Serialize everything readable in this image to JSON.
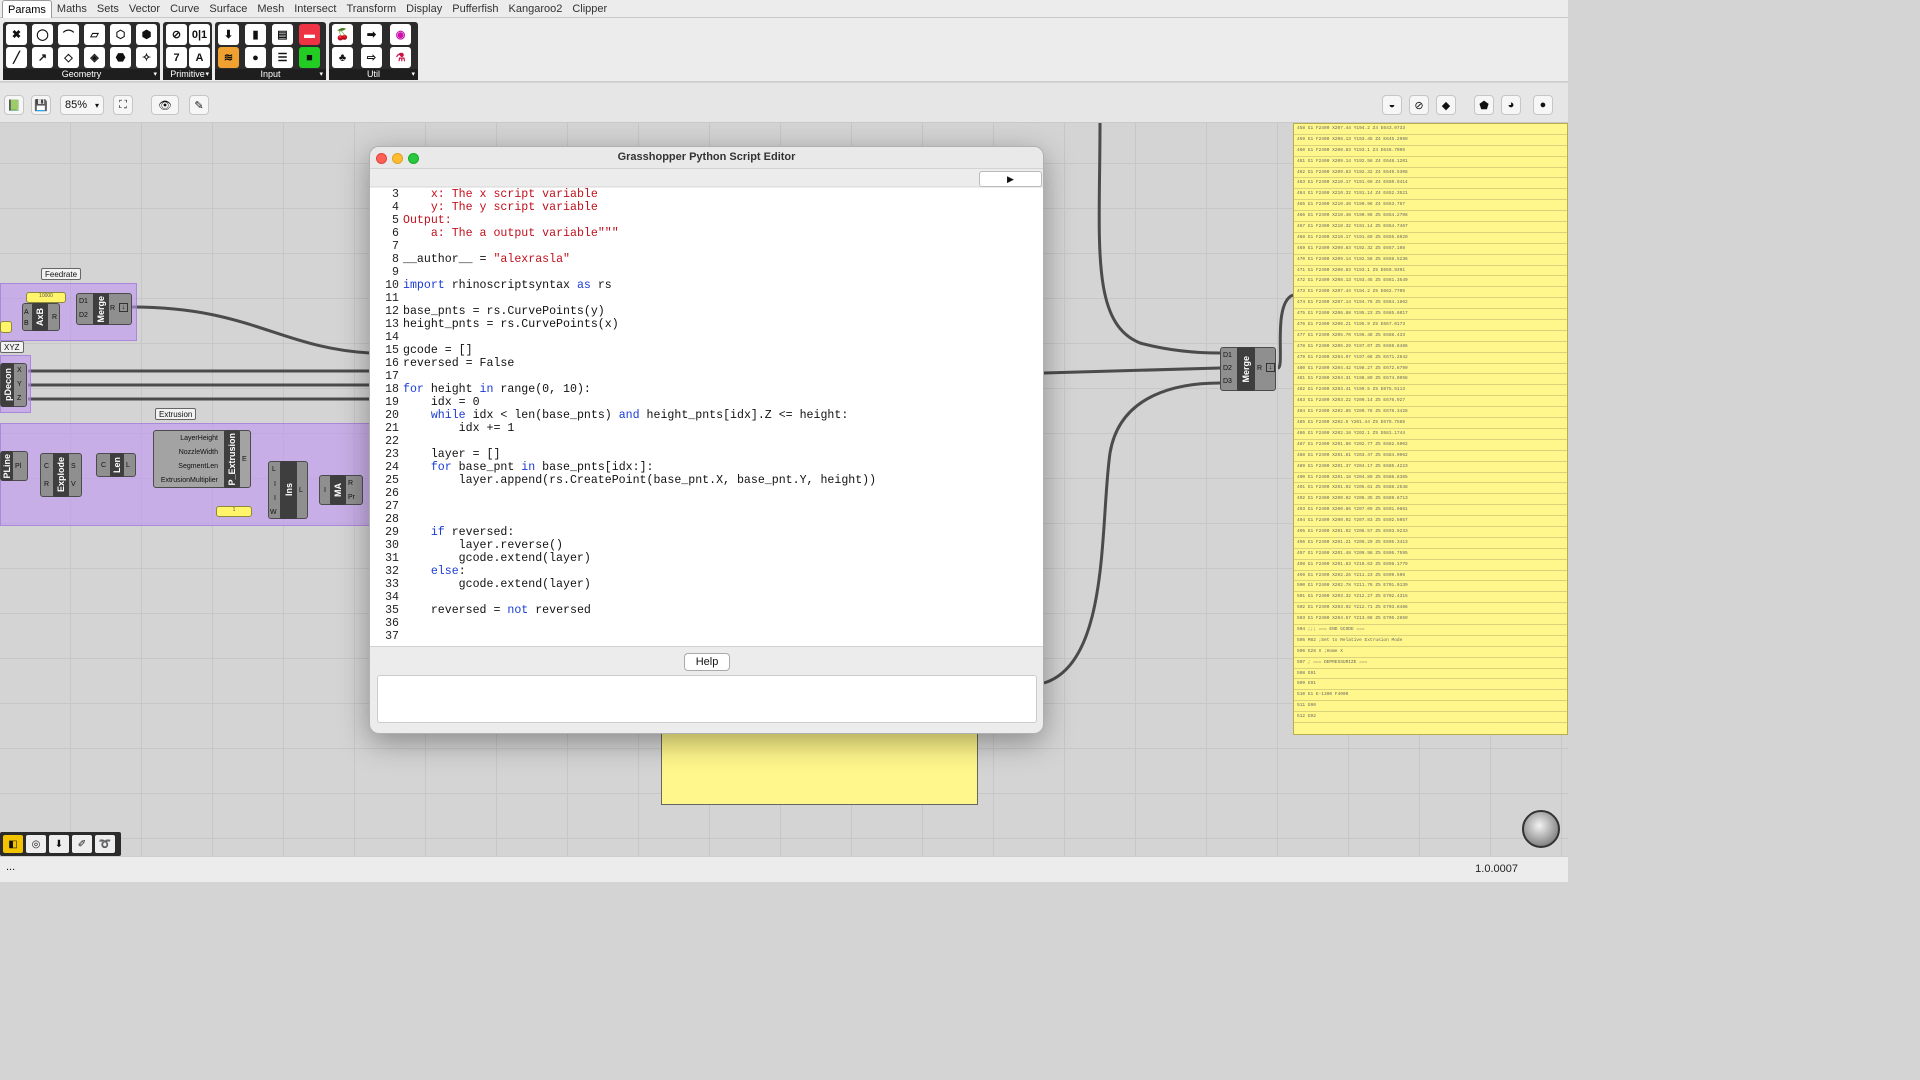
{
  "menu": {
    "tabs": [
      "Params",
      "Maths",
      "Sets",
      "Vector",
      "Curve",
      "Surface",
      "Mesh",
      "Intersect",
      "Transform",
      "Display",
      "Pufferfish",
      "Kangaroo2",
      "Clipper"
    ],
    "active": "Params"
  },
  "ribbon": {
    "geometry_label": "Geometry",
    "primitive_label": "Primitive",
    "input_label": "Input",
    "util_label": "Util",
    "prim_btn_01": "0|1",
    "prim_btn_7": "7",
    "prim_btn_A": "A"
  },
  "toolbar": {
    "zoom_value": "85%"
  },
  "canvas": {
    "group_labels": {
      "feedrate": "Feedrate",
      "xyz": "XYZ",
      "extrusion": "Extrusion"
    },
    "components": {
      "axb": {
        "name": "AxB",
        "inputs": [
          "A",
          "B"
        ],
        "outputs": [
          "R"
        ]
      },
      "merge_left": {
        "name": "Merge",
        "inputs": [
          "D1",
          "D2"
        ],
        "outputs": [
          "R"
        ]
      },
      "pdecon": {
        "name": "pDecon",
        "outputs": [
          "X",
          "Y",
          "Z"
        ]
      },
      "pline": {
        "name": "PLine",
        "outputs": [
          "Pl"
        ]
      },
      "explode": {
        "name": "Explode",
        "inputs": [
          "C"
        ],
        "outputs": [
          "S",
          "V"
        ],
        "right_inputs": [
          "R"
        ]
      },
      "len": {
        "name": "Len",
        "inputs": [
          "C"
        ],
        "outputs": [
          "L"
        ]
      },
      "pextrusion": {
        "name": "P_Extrusion",
        "inputs": [
          "LayerHeight",
          "NozzleWidth",
          "SegmentLen",
          "ExtrusionMultiplier"
        ],
        "outputs": [
          "E"
        ]
      },
      "ins": {
        "name": "Ins",
        "inputs": [
          "L",
          "I",
          "I",
          "W"
        ],
        "outputs": [
          "L"
        ]
      },
      "ma": {
        "name": "MA",
        "inputs": [
          "I"
        ],
        "outputs": [
          "R",
          "Pr"
        ]
      },
      "merge_right": {
        "name": "Merge",
        "inputs": [
          "D1",
          "D2",
          "D3"
        ],
        "outputs": [
          "R"
        ]
      }
    },
    "feedrate_value": "10000",
    "slider_value": "1"
  },
  "gcode_lines": [
    "458 G1  F2400 X207.44 Y194.2 Z4 E643.0733",
    "459 G1  F2400 X208.13 Y193.45 Z4 E645.2989",
    "460 G1  F2400 X208.83 Y193.1 Z4 E646.7095",
    "461 G1  F2400 X209.14 Y192.58 Z4 E648.1201",
    "462 G1  F2400 X209.83 Y192.32 Z4 E649.5308",
    "463 G1  F2400 X210.17 Y191.69 Z4 E650.9414",
    "464 G1  F2400 X210.32 Y191.14 Z4 E652.3521",
    "465 G1  F2400 X210.48 Y190.96 Z4 E653.767",
    "466 G1  F2400 X210.48 Y190.96 Z5 E654.2708",
    "467 G1  F2400 X210.32 Y191.14 Z5 E654.7467",
    "468 G1  F2400 X210.17 Y191.69 Z5 E655.6920",
    "469 G1  F2400 X209.83 Y192.32 Z5 E657.108",
    "470 G1  F2400 X209.14 Y192.58 Z5 E658.5236",
    "471 G1  F2400 X208.83 Y193.1 Z5 E659.9391",
    "472 G1  F2400 X208.13 Y193.45 Z5 E661.3549",
    "473 G1  F2400 X207.44 Y194.2 Z5 E662.7705",
    "474 G1  F2400 X207.14 Y194.76 Z5 E664.1862",
    "475 G1  F2400 X206.88 Y195.23 Z5 E665.6017",
    "476 G1  F2400 X206.21 Y195.9 Z5 E667.0173",
    "477 G1  F2400 X205.70 Y196.48 Z5 E668.433",
    "478 G1  F2400 X205.29 Y197.07 Z5 E669.8486",
    "479 G1  F2400 X204.97 Y197.66 Z5 E671.2642",
    "480 G1  F2400 X204.42 Y198.27 Z5 E672.6799",
    "481 G1  F2400 X204.31 Y198.89 Z5 E674.0956",
    "482 G1  F2400 X203.41 Y199.5 Z5 E675.5113",
    "483 G1  F2400 X203.22 Y200.14 Z5 E676.927",
    "484 G1  F2400 X202.85 Y200.78 Z5 E678.3428",
    "485 G1  F2400 X202.5 Y201.44 Z5 E679.7585",
    "486 G1  F2400 X202.18 Y202.1 Z5 E681.1744",
    "487 G1  F2400 X201.88 Y202.77 Z5 E682.5902",
    "488 G1  F2400 X201.61 Y203.47 Z5 E684.0062",
    "489 G1  F2400 X201.37 Y204.17 Z5 E685.4223",
    "490 G1  F2400 X201.18 Y204.89 Z5 E686.8385",
    "491 G1  F2400 X201.02 Y205.61 Z5 E688.2548",
    "492 G1  F2400 X200.92 Y206.35 Z5 E689.6713",
    "493 G1  F2400 X200.86 Y207.09 Z5 E691.0881",
    "494 G1  F2400 X200.92 Y207.83 Z5 E692.5057",
    "495 G1  F2400 X201.02 Y208.57 Z5 E693.9233",
    "496 G1  F2400 X201.21 Y209.29 Z5 E695.3413",
    "497 G1  F2400 X201.48 Y209.98 Z5 E696.7595",
    "498 G1  F2400 X201.83 Y210.63 Z5 E698.1779",
    "499 G1  F2400 X202.26 Y211.23 Z5 E699.596",
    "500 G1  F2400 X202.78 Y211.76 Z5 E701.0139",
    "501 G1  F2400 X203.32 Y212.27 Z5 E702.4315",
    "502 G1  F2400 X203.92 Y212.71 Z5 E703.8486",
    "503 G1  F2400 X204.57 Y213.08 Z5 E705.2659",
    "504 ;;; === END GCODE ===",
    "505 M82 ;Set to Relative Extrusion Mode",
    "506 G28 X ;Home X",
    "507 ; === DEPRESSURIZE ===",
    "508 G91",
    "509 G91",
    "510 G1 E-1300 F4000",
    "511 G90",
    "512 G92"
  ],
  "editor": {
    "title": "Grasshopper Python Script Editor",
    "run_icon": "▶",
    "help_label": "Help",
    "code_lines": [
      {
        "n": "3",
        "html": "    <span class=\"str\">x: The x script variable</span>"
      },
      {
        "n": "4",
        "html": "    <span class=\"str\">y: The y script variable</span>"
      },
      {
        "n": "5",
        "html": "<span class=\"str\">Output:</span>"
      },
      {
        "n": "6",
        "html": "    <span class=\"str\">a: The a output variable\"\"\"</span>"
      },
      {
        "n": "7",
        "html": ""
      },
      {
        "n": "8",
        "html": "__author__ = <span class=\"str\">\"alexrasla\"</span>"
      },
      {
        "n": "9",
        "html": ""
      },
      {
        "n": "10",
        "html": "<span class=\"kw\">import</span> rhinoscriptsyntax <span class=\"kw\">as</span> rs"
      },
      {
        "n": "11",
        "html": ""
      },
      {
        "n": "12",
        "html": "base_pnts = rs.CurvePoints(y)"
      },
      {
        "n": "13",
        "html": "height_pnts = rs.CurvePoints(x)"
      },
      {
        "n": "14",
        "html": ""
      },
      {
        "n": "15",
        "html": "gcode = []"
      },
      {
        "n": "16",
        "html": "reversed = False"
      },
      {
        "n": "17",
        "html": ""
      },
      {
        "n": "18",
        "html": "<span class=\"kw\">for</span> height <span class=\"kw\">in</span> range(0, 10):"
      },
      {
        "n": "19",
        "html": "    idx = 0"
      },
      {
        "n": "20",
        "html": "    <span class=\"kw\">while</span> idx &lt; len(base_pnts) <span class=\"kw\">and</span> height_pnts[idx].Z &lt;= height:"
      },
      {
        "n": "21",
        "html": "        idx += 1"
      },
      {
        "n": "22",
        "html": ""
      },
      {
        "n": "23",
        "html": "    layer = []"
      },
      {
        "n": "24",
        "html": "    <span class=\"kw\">for</span> base_pnt <span class=\"kw\">in</span> base_pnts[idx:]:"
      },
      {
        "n": "25",
        "html": "        layer.append(rs.CreatePoint(base_pnt.X, base_pnt.Y, height))"
      },
      {
        "n": "26",
        "html": ""
      },
      {
        "n": "27",
        "html": ""
      },
      {
        "n": "28",
        "html": ""
      },
      {
        "n": "29",
        "html": "    <span class=\"kw\">if</span> reversed:"
      },
      {
        "n": "30",
        "html": "        layer.reverse()"
      },
      {
        "n": "31",
        "html": "        gcode.extend(layer)"
      },
      {
        "n": "32",
        "html": "    <span class=\"kw\">else</span>:"
      },
      {
        "n": "33",
        "html": "        gcode.extend(layer)"
      },
      {
        "n": "34",
        "html": ""
      },
      {
        "n": "35",
        "html": "    reversed = <span class=\"kw\">not</span> reversed"
      },
      {
        "n": "36",
        "html": ""
      },
      {
        "n": "37",
        "html": ""
      }
    ]
  },
  "status": {
    "left": "...",
    "version": "1.0.0007"
  },
  "colors": {
    "group_purple": "#be96f0",
    "panel_yellow": "#fff78b",
    "keyword_blue": "#1a3bd6",
    "string_red": "#c0101c"
  }
}
